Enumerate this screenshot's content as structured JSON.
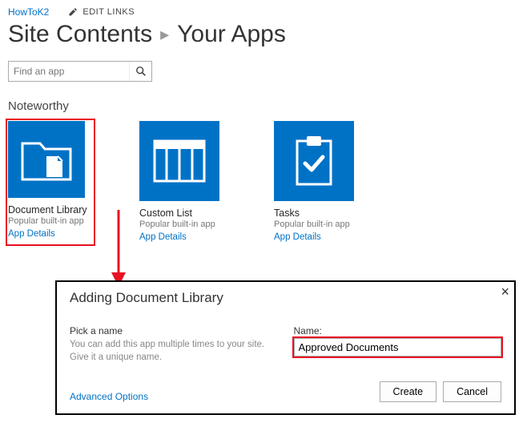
{
  "header": {
    "site_link": "HowToK2",
    "edit_links": "EDIT LINKS"
  },
  "page": {
    "title_left": "Site Contents",
    "title_right": "Your Apps"
  },
  "search": {
    "placeholder": "Find an app"
  },
  "section": {
    "noteworthy": "Noteworthy"
  },
  "tiles": [
    {
      "title": "Document Library",
      "subtitle": "Popular built-in app",
      "details": "App Details"
    },
    {
      "title": "Custom List",
      "subtitle": "Popular built-in app",
      "details": "App Details"
    },
    {
      "title": "Tasks",
      "subtitle": "Popular built-in app",
      "details": "App Details"
    }
  ],
  "dialog": {
    "title": "Adding Document Library",
    "pick_label": "Pick a name",
    "pick_desc": "You can add this app multiple times to your site. Give it a unique name.",
    "name_label": "Name:",
    "name_value": "Approved Documents",
    "advanced": "Advanced Options",
    "create": "Create",
    "cancel": "Cancel"
  }
}
